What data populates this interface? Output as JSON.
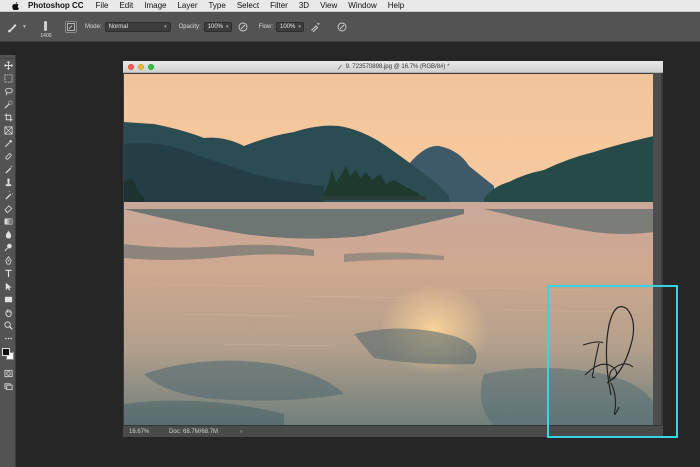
{
  "menubar": {
    "app_name": "Photoshop CC",
    "items": [
      "File",
      "Edit",
      "Image",
      "Layer",
      "Type",
      "Select",
      "Filter",
      "3D",
      "View",
      "Window",
      "Help"
    ]
  },
  "options": {
    "brush_size": "1400",
    "mode_label": "Mode:",
    "mode_value": "Normal",
    "opacity_label": "Opacity:",
    "opacity_value": "100%",
    "flow_label": "Flow:",
    "flow_value": "100%"
  },
  "document": {
    "title": "9. 723570898.jpg @ 16.7% (RGB/8#) *"
  },
  "status": {
    "zoom": "16.67%",
    "doc_size": "Doc: 68.7M/68.7M",
    "arrow": "›"
  },
  "colors": {
    "highlight": "#35d5e3",
    "panel": "#535353",
    "workspace": "#262626"
  }
}
